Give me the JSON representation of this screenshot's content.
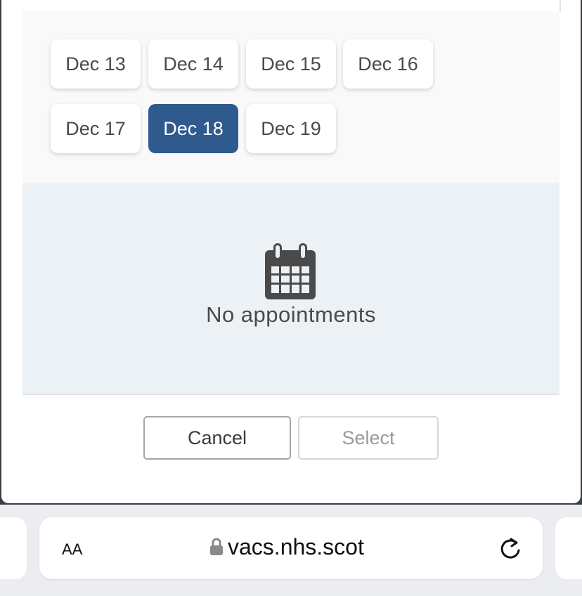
{
  "dates": [
    {
      "label": "Dec 13",
      "selected": false
    },
    {
      "label": "Dec 14",
      "selected": false
    },
    {
      "label": "Dec 15",
      "selected": false
    },
    {
      "label": "Dec 16",
      "selected": false
    },
    {
      "label": "Dec 17",
      "selected": false
    },
    {
      "label": "Dec 18",
      "selected": true
    },
    {
      "label": "Dec 19",
      "selected": false
    }
  ],
  "empty_state": {
    "icon": "calendar-icon",
    "message": "No appointments"
  },
  "actions": {
    "cancel_label": "Cancel",
    "select_label": "Select"
  },
  "browser": {
    "text_size_label": "AA",
    "url": "vacs.nhs.scot",
    "lock_icon": "lock-icon",
    "reload_icon": "reload-icon"
  },
  "colors": {
    "selected_date": "#2f5a8e",
    "empty_panel_bg": "#ecf1f5"
  }
}
